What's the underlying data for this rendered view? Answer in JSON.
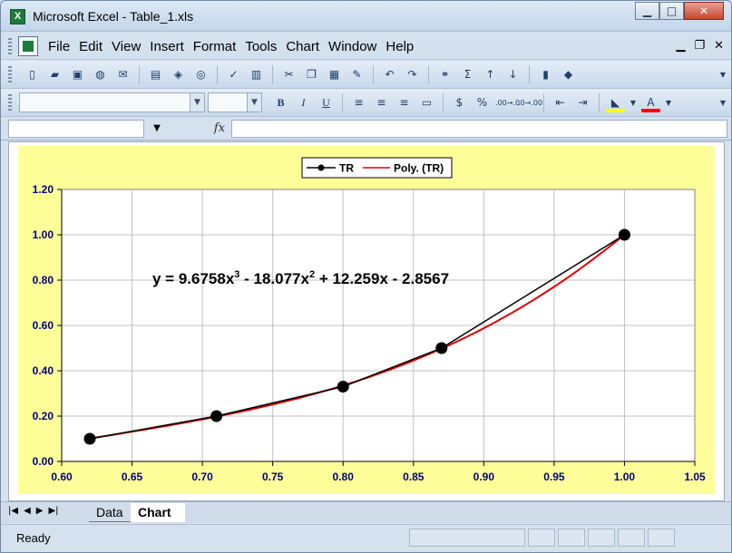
{
  "window": {
    "title": "Microsoft Excel - Table_1.xls",
    "app_icon": "X",
    "minimize": "▁",
    "maximize": "□",
    "close": "✕"
  },
  "menubar": {
    "items": [
      "File",
      "Edit",
      "View",
      "Insert",
      "Format",
      "Tools",
      "Chart",
      "Window",
      "Help"
    ],
    "mdi_minimize": "▁",
    "mdi_restore": "❐",
    "mdi_close": "✕"
  },
  "toolbar_standard": {
    "icons": [
      "new-icon",
      "open-icon",
      "save-icon",
      "permission-icon",
      "email-icon",
      "print-icon",
      "print-preview-icon",
      "research-icon",
      "spelling-icon",
      "cut-icon",
      "copy-icon",
      "paste-icon",
      "format-painter-icon",
      "undo-icon",
      "redo-icon",
      "hyperlink-icon",
      "autosum-icon",
      "sort-ascending-icon",
      "sort-descending-icon",
      "chart-wizard-icon",
      "drawing-icon"
    ]
  },
  "toolbar_formatting": {
    "font_name": "",
    "font_size": "",
    "bold": "B",
    "italic": "I",
    "underline": "U",
    "currency": "$",
    "percent": "%",
    "increase_decimal": ".00→.0",
    "decrease_decimal": ".0→.00",
    "fill_color": "#ffff00",
    "font_color": "#ff0000",
    "font_color_letter": "A"
  },
  "formula_bar": {
    "name_box": "",
    "fx_label": "fx",
    "formula": ""
  },
  "chart": {
    "legend": {
      "series_label": "TR",
      "trend_label": "Poly. (TR)"
    },
    "equation_prefix": "y = 9.6758x",
    "equation_sup1": "3",
    "equation_mid": " - 18.077x",
    "equation_sup2": "2",
    "equation_suffix": " + 12.259x - 2.8567",
    "colors": {
      "background": "#ffff99",
      "plot": "#ffffff",
      "series": "#000000",
      "trend": "#dd0000",
      "axis_text": "#000080"
    }
  },
  "chart_data": {
    "type": "scatter",
    "title": "",
    "xlabel": "",
    "ylabel": "",
    "xlim": [
      0.6,
      1.05
    ],
    "ylim": [
      0.0,
      1.2
    ],
    "x_ticks": [
      "0.60",
      "0.65",
      "0.70",
      "0.75",
      "0.80",
      "0.85",
      "0.90",
      "0.95",
      "1.00",
      "1.05"
    ],
    "y_ticks": [
      "0.00",
      "0.20",
      "0.40",
      "0.60",
      "0.80",
      "1.00",
      "1.20"
    ],
    "grid": true,
    "legend_position": "top",
    "series": [
      {
        "name": "TR",
        "x": [
          0.62,
          0.71,
          0.8,
          0.87,
          1.0
        ],
        "y": [
          0.1,
          0.2,
          0.33,
          0.5,
          1.0
        ]
      }
    ],
    "trendline": {
      "name": "Poly. (TR)",
      "type": "polynomial",
      "order": 3,
      "coefficients": [
        9.6758,
        -18.077,
        12.259,
        -2.8567
      ]
    }
  },
  "sheet_tabs": {
    "nav": [
      "|◀",
      "◀",
      "▶",
      "▶|"
    ],
    "tabs": [
      "Data",
      "Chart"
    ],
    "active": "Chart"
  },
  "statusbar": {
    "text": "Ready"
  }
}
